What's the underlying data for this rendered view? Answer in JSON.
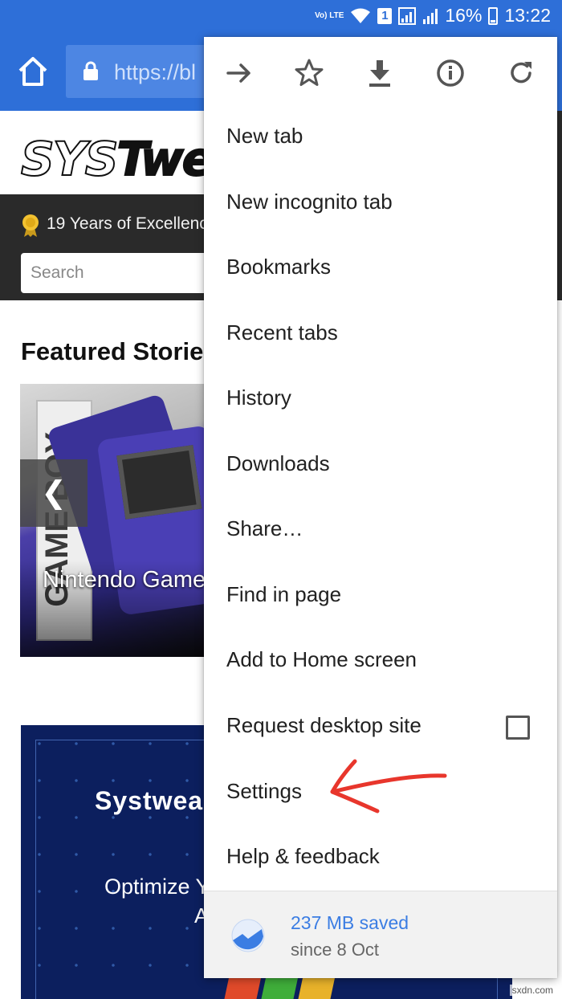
{
  "status_bar": {
    "volte": "Vo) LTE",
    "sim": "1",
    "battery": "16%",
    "time": "13:22"
  },
  "toolbar": {
    "url": "https://bl"
  },
  "page": {
    "tagline": "19 Years of Excellenc",
    "search_placeholder": "Search",
    "featured_heading": "Featured Storie",
    "slide_title": "Nintendo Game",
    "prev_label": "❮",
    "box_text": "GAME BOY",
    "banner_title": "Systwea",
    "banner_sub": "Optimize Y",
    "banner_sub2": "A"
  },
  "menu": {
    "icons": [
      "forward-icon",
      "bookmark-star-icon",
      "download-icon",
      "info-icon",
      "reload-icon"
    ],
    "items": [
      {
        "label": "New tab"
      },
      {
        "label": "New incognito tab"
      },
      {
        "label": "Bookmarks"
      },
      {
        "label": "Recent tabs"
      },
      {
        "label": "History"
      },
      {
        "label": "Downloads"
      },
      {
        "label": "Share…"
      },
      {
        "label": "Find in page"
      },
      {
        "label": "Add to Home screen"
      },
      {
        "label": "Request desktop site",
        "checked": false
      },
      {
        "label": "Settings"
      },
      {
        "label": "Help & feedback"
      }
    ],
    "footer": {
      "amount": "237 MB saved",
      "since": "since 8 Oct"
    }
  },
  "colors": {
    "chrome_blue": "#2e6fd8",
    "saver_blue": "#3b7de3",
    "annotation_red": "#e8362c"
  },
  "watermark": "sxdn.com"
}
